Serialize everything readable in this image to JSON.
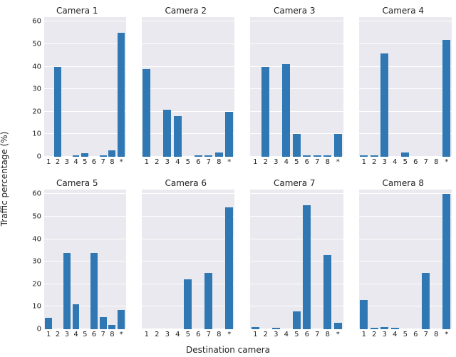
{
  "ylabel": "Traffic percentage (%)",
  "xlabel": "Destination camera",
  "bar_color": "#2f78b3",
  "chart_data": [
    {
      "type": "bar",
      "title": "Camera 1",
      "categories": [
        "1",
        "2",
        "3",
        "4",
        "5",
        "6",
        "7",
        "8",
        "*"
      ],
      "values": [
        0,
        40,
        0,
        0.5,
        1.5,
        0,
        0.5,
        3,
        55
      ],
      "ylim": [
        0,
        62
      ],
      "yticks": [
        0,
        10,
        20,
        30,
        40,
        50,
        60
      ],
      "show_yticks": true
    },
    {
      "type": "bar",
      "title": "Camera 2",
      "categories": [
        "1",
        "2",
        "3",
        "4",
        "5",
        "6",
        "7",
        "8",
        "*"
      ],
      "values": [
        39,
        0,
        21,
        18,
        0,
        0.5,
        0.5,
        2,
        20
      ],
      "ylim": [
        0,
        62
      ],
      "yticks": [
        0,
        10,
        20,
        30,
        40,
        50,
        60
      ],
      "show_yticks": false
    },
    {
      "type": "bar",
      "title": "Camera 3",
      "categories": [
        "1",
        "2",
        "3",
        "4",
        "5",
        "6",
        "7",
        "8",
        "*"
      ],
      "values": [
        0,
        40,
        0,
        41,
        10,
        0.5,
        0.5,
        0.5,
        10
      ],
      "ylim": [
        0,
        62
      ],
      "yticks": [
        0,
        10,
        20,
        30,
        40,
        50,
        60
      ],
      "show_yticks": false
    },
    {
      "type": "bar",
      "title": "Camera 4",
      "categories": [
        "1",
        "2",
        "3",
        "4",
        "5",
        "6",
        "7",
        "8",
        "*"
      ],
      "values": [
        0.5,
        0.5,
        46,
        0,
        2,
        0,
        0,
        0,
        52
      ],
      "ylim": [
        0,
        62
      ],
      "yticks": [
        0,
        10,
        20,
        30,
        40,
        50,
        60
      ],
      "show_yticks": false
    },
    {
      "type": "bar",
      "title": "Camera 5",
      "categories": [
        "1",
        "2",
        "3",
        "4",
        "5",
        "6",
        "7",
        "8",
        "*"
      ],
      "values": [
        5,
        0,
        34,
        11,
        0,
        34,
        5.5,
        2,
        8.5
      ],
      "ylim": [
        0,
        62
      ],
      "yticks": [
        0,
        10,
        20,
        30,
        40,
        50,
        60
      ],
      "show_yticks": true
    },
    {
      "type": "bar",
      "title": "Camera 6",
      "categories": [
        "1",
        "2",
        "3",
        "4",
        "5",
        "6",
        "7",
        "8",
        "*"
      ],
      "values": [
        0,
        0,
        0,
        0,
        22,
        0,
        25,
        0,
        54
      ],
      "ylim": [
        0,
        62
      ],
      "yticks": [
        0,
        10,
        20,
        30,
        40,
        50,
        60
      ],
      "show_yticks": false
    },
    {
      "type": "bar",
      "title": "Camera 7",
      "categories": [
        "1",
        "2",
        "3",
        "4",
        "5",
        "6",
        "7",
        "8",
        "*"
      ],
      "values": [
        1,
        0,
        0.5,
        0,
        8,
        55,
        0,
        33,
        3
      ],
      "ylim": [
        0,
        62
      ],
      "yticks": [
        0,
        10,
        20,
        30,
        40,
        50,
        60
      ],
      "show_yticks": false
    },
    {
      "type": "bar",
      "title": "Camera 8",
      "categories": [
        "1",
        "2",
        "3",
        "4",
        "5",
        "6",
        "7",
        "8",
        "*"
      ],
      "values": [
        13,
        0.5,
        1,
        0.5,
        0,
        0,
        25,
        0,
        60
      ],
      "ylim": [
        0,
        62
      ],
      "yticks": [
        0,
        10,
        20,
        30,
        40,
        50,
        60
      ],
      "show_yticks": false
    }
  ]
}
